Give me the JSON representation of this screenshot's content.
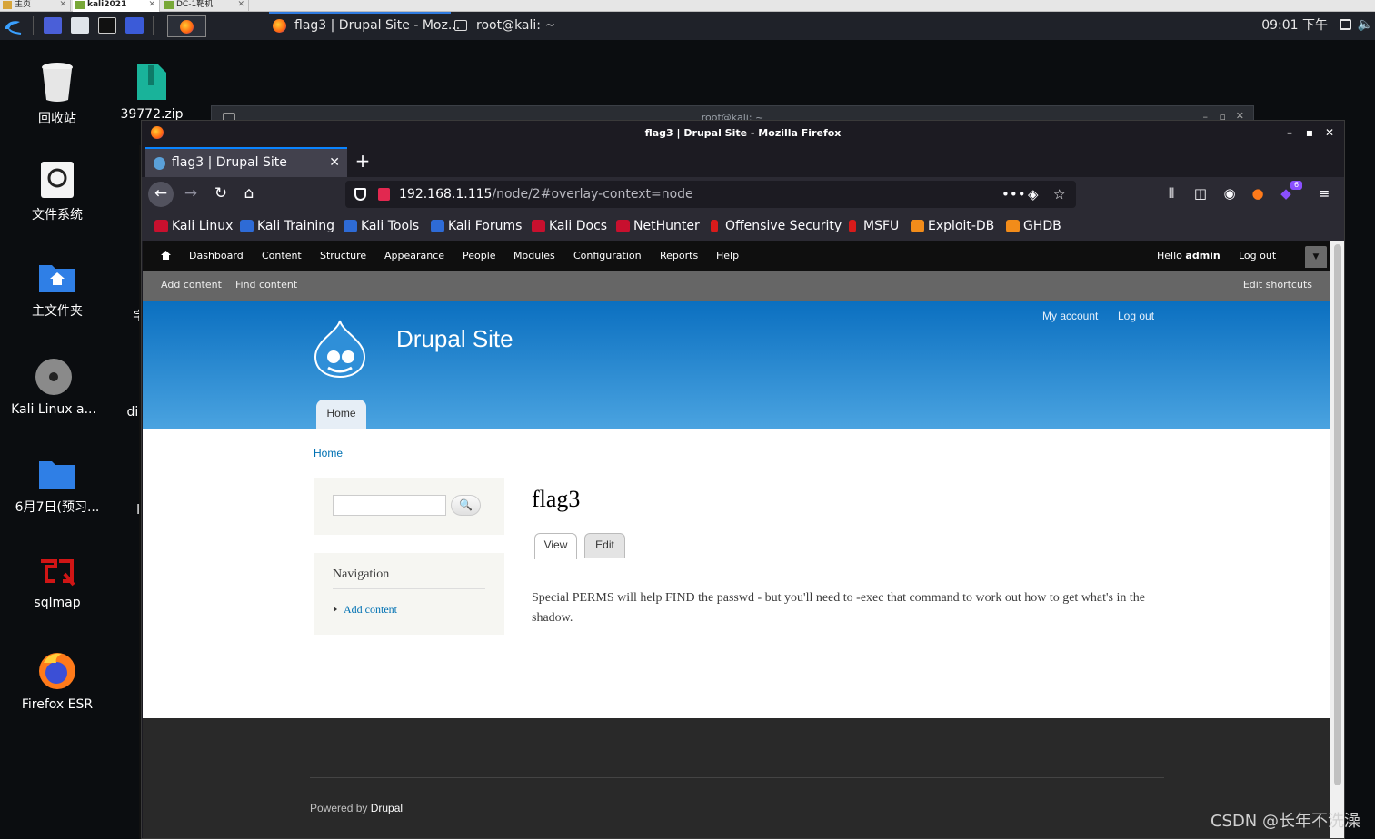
{
  "vm_tabs": [
    "主页",
    "kali2021",
    "DC-1靶机"
  ],
  "panel": {
    "tasks": [
      {
        "label": "flag3 | Drupal Site - Moz..."
      },
      {
        "label": "root@kali: ~"
      }
    ],
    "clock": "09:01 下午"
  },
  "desktop": {
    "icons": [
      {
        "label": "回收站"
      },
      {
        "label": "39772.zip"
      },
      {
        "label": "文件系统"
      },
      {
        "label": "主文件夹"
      },
      {
        "label": "Kali Linux a..."
      },
      {
        "label": "6月7日(预习..."
      },
      {
        "label": "sqlmap"
      },
      {
        "label": "Firefox ESR"
      }
    ],
    "partial_labels": [
      "2",
      "字",
      "dir",
      "l"
    ]
  },
  "terminal": {
    "title": "root@kali: ~"
  },
  "firefox": {
    "window_title": "flag3 | Drupal Site - Mozilla Firefox",
    "tab": {
      "title": "flag3 | Drupal Site"
    },
    "url": {
      "host": "192.168.1.115",
      "path": "/node/2#overlay-context=node"
    },
    "extension_badge": "6",
    "bookmarks": [
      "Kali Linux",
      "Kali Training",
      "Kali Tools",
      "Kali Forums",
      "Kali Docs",
      "NetHunter",
      "Offensive Security",
      "MSFU",
      "Exploit-DB",
      "GHDB"
    ]
  },
  "drupal": {
    "admin_menu": [
      "Dashboard",
      "Content",
      "Structure",
      "Appearance",
      "People",
      "Modules",
      "Configuration",
      "Reports",
      "Help"
    ],
    "hello_prefix": "Hello ",
    "user": "admin",
    "logout": "Log out",
    "shortcuts": [
      "Add content",
      "Find content"
    ],
    "edit_shortcuts": "Edit shortcuts",
    "site_name": "Drupal Site",
    "header_links": [
      "My account",
      "Log out"
    ],
    "main_tab": "Home",
    "breadcrumb": "Home",
    "nav_title": "Navigation",
    "nav_item": "Add content",
    "page_title": "flag3",
    "tabs": [
      "View",
      "Edit"
    ],
    "body": "Special PERMS will help FIND the passwd - but you'll need to -exec that command to work out how to get what's in the shadow.",
    "footer_prefix": "Powered by ",
    "footer_link": "Drupal"
  },
  "watermark": "CSDN @长年不洗澡"
}
